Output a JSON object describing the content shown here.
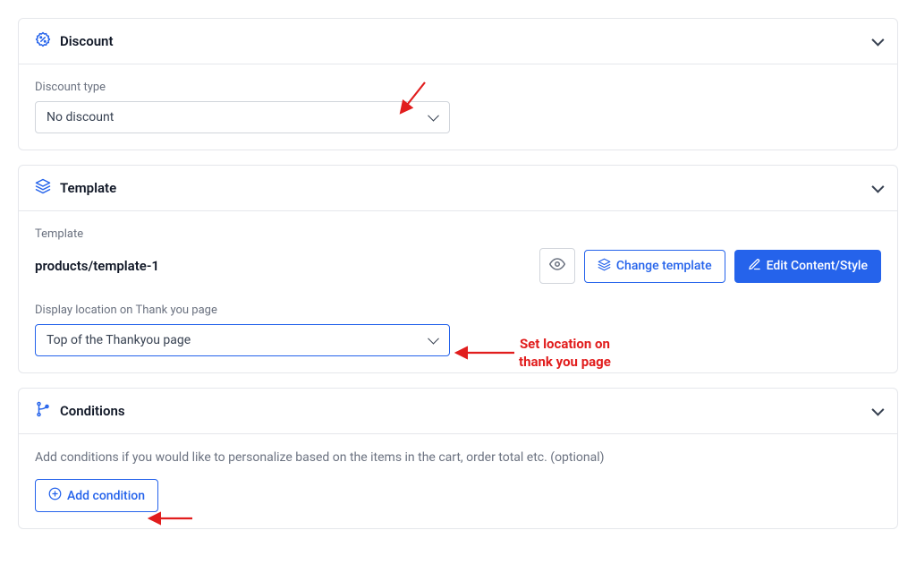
{
  "discount": {
    "title": "Discount",
    "type_label": "Discount type",
    "selected": "No discount"
  },
  "template": {
    "title": "Template",
    "label": "Template",
    "name": "products/template-1",
    "change_btn": "Change template",
    "edit_btn": "Edit Content/Style",
    "display_loc_label": "Display location on Thank you page",
    "display_loc_value": "Top of the Thankyou page"
  },
  "conditions": {
    "title": "Conditions",
    "help": "Add conditions if you would like to personalize based on the items in the cart, order total etc. (optional)",
    "add_btn": "Add condition"
  },
  "annotations": {
    "set_location": "Set location on\nthank you page"
  }
}
